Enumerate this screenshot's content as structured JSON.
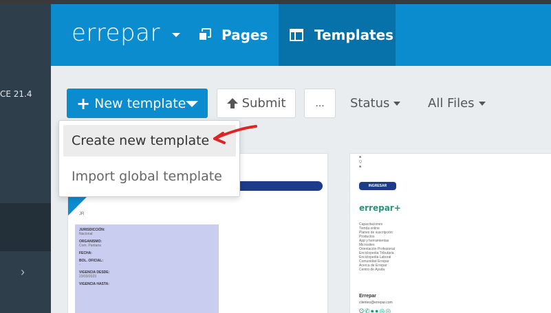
{
  "sidebar": {
    "version_text": "CE 21.4",
    "expand_icon": "chevron-right-icon"
  },
  "header": {
    "logo": "errepar",
    "nav": [
      {
        "label": "Pages",
        "icon": "pages-icon",
        "active": false
      },
      {
        "label": "Templates",
        "icon": "templates-icon",
        "active": true
      }
    ]
  },
  "toolbar": {
    "new_template_label": "New template",
    "submit_label": "Submit",
    "more_label": "...",
    "status_label": "Status",
    "files_label": "All Files"
  },
  "dropdown": {
    "items": [
      {
        "label": "Create new template",
        "highlighted": true
      },
      {
        "label": "Import global template",
        "highlighted": false
      }
    ]
  },
  "cards": {
    "card1": {
      "small_text": "JR",
      "form": [
        {
          "label": "JURISDICCIÓN:",
          "value": "Nacional"
        },
        {
          "label": "ORGANISMO:",
          "value": "Com. Paritaria"
        },
        {
          "label": "FECHA:",
          "value": ""
        },
        {
          "label": "BOL. OFICIAL:",
          "value": "-"
        },
        {
          "label": "VIGENCIA DESDE:",
          "value": "23/03/2023"
        },
        {
          "label": "VIGENCIA HASTA:",
          "value": ""
        }
      ]
    },
    "card2": {
      "top_lines": [
        "■",
        "Q",
        "■"
      ],
      "button": "INGRESAR",
      "logo": "errepar+",
      "links": [
        "Capacitaciones",
        "Tienda online",
        "Planes de suscripción",
        "Productos",
        "App y herramientas",
        "Microsites",
        "Orientación Profesional",
        "Enciclopedia Tributaria",
        "Enciclopedia Laboral",
        "Comunidad Errepar",
        "Acerca de Errepar",
        "Centro de Ayuda"
      ],
      "footer_title": "Errepar",
      "footer_mail": "clientes@errepar.com",
      "social": "ʘ✆●●◎◎"
    }
  },
  "colors": {
    "header": "#0a8ccf",
    "header_active": "#0672a9",
    "sidebar": "#2e3e4a",
    "annotation_arrow": "#e02424"
  }
}
